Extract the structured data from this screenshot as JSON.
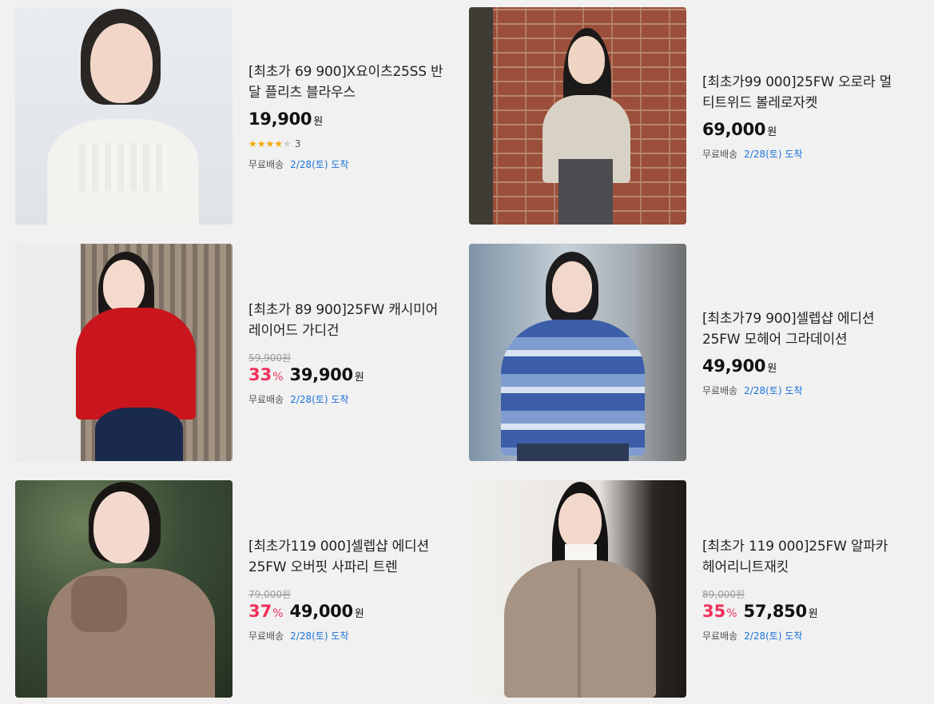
{
  "products": [
    {
      "title": "[최초가 69 900]X요이츠25SS 반달 플리츠 블라우스",
      "original_price": "",
      "discount": "",
      "discount_pct_sign": "",
      "price": "19,900",
      "won": "원",
      "rating_stars": 4,
      "rating_count": "3",
      "shipping_label": "무료배송",
      "shipping_date": "2/28(토) 도착",
      "image_alt": "white cable knit sweater model"
    },
    {
      "title": "[최초가99 000]25FW 오로라 멀티트위드 볼레로자켓",
      "original_price": "",
      "discount": "",
      "discount_pct_sign": "",
      "price": "69,000",
      "won": "원",
      "shipping_label": "무료배송",
      "shipping_date": "2/28(토) 도착",
      "image_alt": "tweed bolero jacket model by brick wall"
    },
    {
      "title": "[최초가 89 900]25FW 캐시미어 레이어드 가디건",
      "original_price": "59,900원",
      "discount": "33",
      "discount_pct_sign": "%",
      "price": "39,900",
      "won": "원",
      "shipping_label": "무료배송",
      "shipping_date": "2/28(토) 도착",
      "image_alt": "red cashmere cardigan model"
    },
    {
      "title": "[최초가79 900]셀렙샵 에디션 25FW 모헤어 그라데이션",
      "original_price": "",
      "discount": "",
      "discount_pct_sign": "",
      "price": "49,900",
      "won": "원",
      "shipping_label": "무료배송",
      "shipping_date": "2/28(토) 도착",
      "image_alt": "blue mohair gradation sweater model"
    },
    {
      "title": "[최초가119 000]셀렙샵 에디션 25FW 오버핏 사파리 트렌",
      "original_price": "79,000원",
      "discount": "37",
      "discount_pct_sign": "%",
      "price": "49,000",
      "won": "원",
      "shipping_label": "무료배송",
      "shipping_date": "2/28(토) 도착",
      "image_alt": "beige safari trench coat model"
    },
    {
      "title": "[최초가 119 000]25FW 알파카 헤어리니트재킷",
      "original_price": "89,000원",
      "discount": "35",
      "discount_pct_sign": "%",
      "price": "57,850",
      "won": "원",
      "shipping_label": "무료배송",
      "shipping_date": "2/28(토) 도착",
      "image_alt": "alpaca hairy knit jacket model"
    }
  ],
  "colors": {
    "discount": "#f0305a",
    "shipping_date": "#1a73d9",
    "star_on": "#f5a800",
    "star_off": "#cfcfcf",
    "background": "#f1f1f1"
  }
}
